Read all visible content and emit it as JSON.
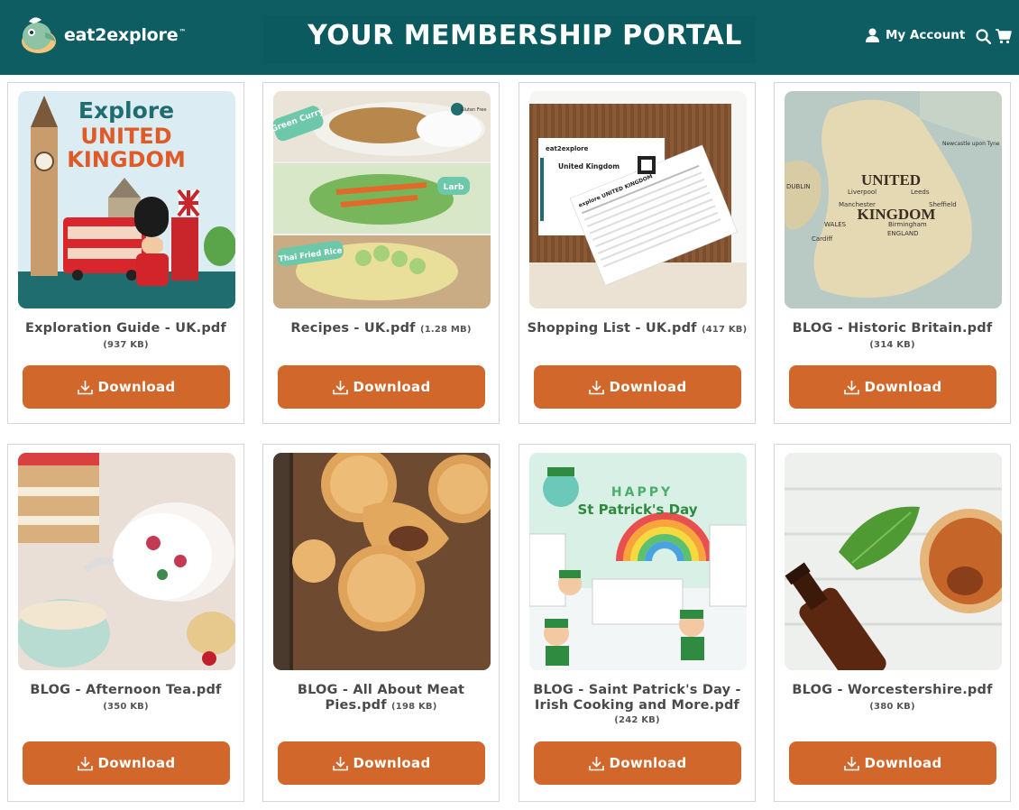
{
  "header": {
    "logo_text": "eat2explore",
    "logo_tm": "™",
    "portal_title": "YOUR MEMBERSHIP PORTAL",
    "account_label": "My Account",
    "colors": {
      "header_bg": "#0e5d62",
      "button_bg": "#d2672c"
    },
    "icons": [
      "user-icon",
      "search-icon",
      "cart-icon"
    ]
  },
  "cards": [
    {
      "title": "Exploration Guide - UK.pdf",
      "size": "(937 KB)",
      "button_label": "Download",
      "image": "explore-united-kingdom-cover",
      "image_text": {
        "line1": "Explore",
        "line2": "UNITED",
        "line3": "KINGDOM"
      }
    },
    {
      "title": "Recipes - UK.pdf",
      "size": "(1.28 MB)",
      "button_label": "Download",
      "image": "recipe-collage",
      "image_text": {
        "tag1": "Green Curry",
        "tag2": "Larb",
        "tag3": "Thai Fried Rice",
        "badge": "Gluten Free"
      }
    },
    {
      "title": "Shopping List - UK.pdf",
      "size": "(417 KB)",
      "button_label": "Download",
      "image": "shopping-list-cards",
      "image_text": {
        "brand": "eat2explore",
        "card_title": "United Kingdom",
        "list_title": "explore UNITED KINGDOM"
      }
    },
    {
      "title": "BLOG - Historic Britain.pdf",
      "size": "(314 KB)",
      "button_label": "Download",
      "image": "map-of-britain",
      "image_text": {
        "country1": "UNITED",
        "country2": "KINGDOM",
        "cities": [
          "Newcastle upon Tyne",
          "Leeds",
          "Liverpool",
          "Manchester",
          "Sheffield",
          "Birmingham",
          "WALES",
          "ENGLAND",
          "Cardiff",
          "DUBLIN"
        ]
      }
    },
    {
      "title": "BLOG - Afternoon Tea.pdf",
      "size": "(350 KB)",
      "button_label": "Download",
      "image": "afternoon-tea-photo"
    },
    {
      "title": "BLOG - All About Meat Pies.pdf",
      "size": "(198 KB)",
      "button_label": "Download",
      "image": "meat-pies-photo"
    },
    {
      "title": "BLOG - Saint Patrick's Day - Irish Cooking and More.pdf",
      "size": "(242 KB)",
      "button_label": "Download",
      "image": "st-patricks-day-illustration",
      "image_text": {
        "line1": "HAPPY",
        "line2": "St Patrick's Day"
      }
    },
    {
      "title": "BLOG - Worcestershire.pdf",
      "size": "(380 KB)",
      "button_label": "Download",
      "image": "worcestershire-sauce-photo"
    }
  ]
}
